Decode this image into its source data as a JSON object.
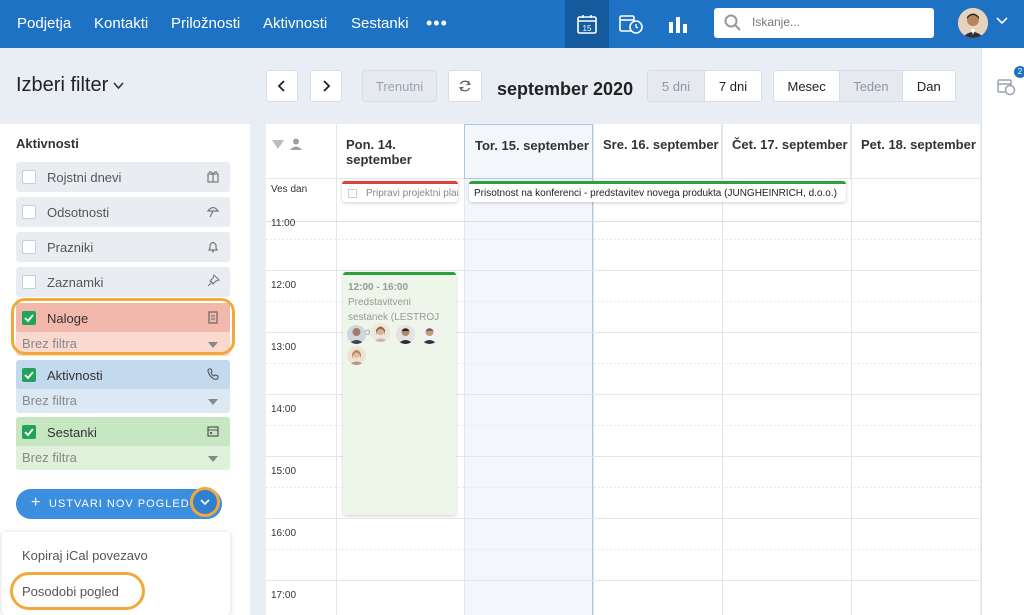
{
  "topbar": {
    "nav": [
      "Podjetja",
      "Kontakti",
      "Priložnosti",
      "Aktivnosti",
      "Sestanki"
    ],
    "more": "•••",
    "calendar_day": "15",
    "search_placeholder": "Iskanje..."
  },
  "rightrail": {
    "badge": "2"
  },
  "header": {
    "filter_title": "Izberi filter",
    "today_btn": "Trenutni",
    "month": "september 2020",
    "range": [
      "5 dni",
      "7 dni"
    ],
    "view": [
      "Mesec",
      "Teden",
      "Dan"
    ]
  },
  "left": {
    "heading": "Aktivnosti",
    "filters": [
      {
        "label": "Rojstni dnevi",
        "checked": false,
        "icon": "gift-icon"
      },
      {
        "label": "Odsotnosti",
        "checked": false,
        "icon": "umbrella-icon"
      },
      {
        "label": "Prazniki",
        "checked": false,
        "icon": "bell-icon"
      },
      {
        "label": "Zaznamki",
        "checked": false,
        "icon": "pin-icon"
      },
      {
        "label": "Naloge",
        "checked": true,
        "icon": "clipboard-icon",
        "sub": "Brez filtra",
        "color": "#f2b8ab"
      },
      {
        "label": "Aktivnosti",
        "checked": true,
        "icon": "phone-icon",
        "sub": "Brez filtra",
        "color": "#c2d9ee"
      },
      {
        "label": "Sestanki",
        "checked": true,
        "icon": "calendar-icon",
        "sub": "Brez filtra",
        "color": "#c7e7c2"
      }
    ],
    "create_btn": "USTVARI NOV POGLED",
    "menu": [
      "Kopiraj iCal povezavo",
      "Posodobi pogled"
    ]
  },
  "calendar": {
    "days": [
      "Pon. 14. september",
      "Tor. 15. september",
      "Sre. 16. september",
      "Čet. 17. september",
      "Pet. 18. september"
    ],
    "allday_label": "Ves dan",
    "times": [
      "11:00",
      "12:00",
      "13:00",
      "14:00",
      "15:00",
      "16:00",
      "17:00"
    ],
    "allday_events": [
      {
        "title": "Pripravi projektni plan",
        "color": "#d9443a"
      },
      {
        "title": "Prisotnost na konferenci - predstavitev novega produkta (JUNGHEINRICH, d.o.o.)",
        "color": "#2d9f3c"
      }
    ],
    "event": {
      "time": "12:00 - 16:00",
      "title": "Predstavitveni sestanek (LESTROJ d.o.o.)"
    }
  }
}
